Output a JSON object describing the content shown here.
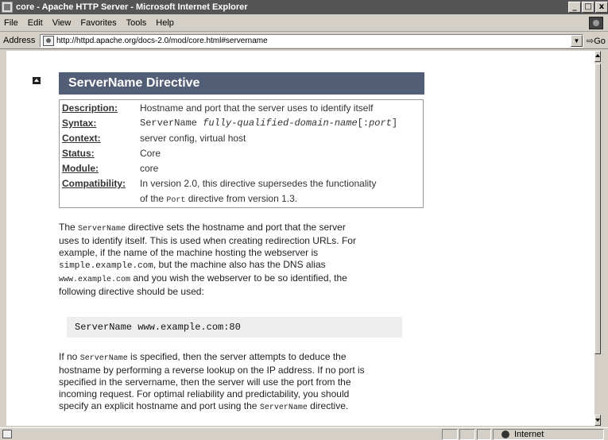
{
  "window": {
    "title": "core - Apache HTTP Server - Microsoft Internet Explorer",
    "controls": {
      "minimize": "_",
      "maximize": "□",
      "close": "x"
    }
  },
  "menu": [
    "File",
    "Edit",
    "View",
    "Favorites",
    "Tools",
    "Help"
  ],
  "address": {
    "label": "Address",
    "url": "http://httpd.apache.org/docs-2.0/mod/core.html#servername",
    "go_label": "Go"
  },
  "doc": {
    "heading": "ServerName Directive",
    "summary": {
      "description_label": "Description:",
      "description": "Hostname and port that the server uses to identify itself",
      "syntax_label": "Syntax:",
      "syntax_cmd": "ServerName ",
      "syntax_arg": "fully-qualified-domain-name",
      "syntax_opt_open": "[:",
      "syntax_port": "port",
      "syntax_opt_close": "]",
      "context_label": "Context:",
      "context": "server config, virtual host",
      "status_label": "Status:",
      "status": "Core",
      "module_label": "Module:",
      "module": "core",
      "compat_label": "Compatibility:",
      "compat_line1": "In version 2.0, this directive supersedes the functionality",
      "compat_line2_a": "of the ",
      "compat_line2_code": "Port",
      "compat_line2_b": " directive from version 1.3."
    },
    "para1": {
      "l1_a": "The ",
      "l1_code": "ServerName",
      "l1_b": " directive sets the hostname and port that the server",
      "l2": "uses to identify itself. This is used when creating redirection URLs. For",
      "l3": "example, if the name of the machine hosting the webserver is",
      "l4_code": "simple.example.com",
      "l4_b": ", but the machine also has the DNS alias",
      "l5_code": "www.example.com",
      "l5_b": " and you wish the webserver to be so identified, the",
      "l6": "following directive should be used:"
    },
    "example": "ServerName www.example.com:80",
    "para2": {
      "l1_a": "If no ",
      "l1_code": "ServerName",
      "l1_b": " is specified, then the server attempts to deduce the",
      "l2": "hostname by performing a reverse lookup on the IP address. If no port is",
      "l3": "specified in the servername, then the server will use the port from the",
      "l4": "incoming request. For optimal reliability and predictability, you should",
      "l5_a": "specify an explicit hostname and port using the ",
      "l5_code": "ServerName",
      "l5_b": " directive."
    }
  },
  "status": {
    "zone": "Internet"
  },
  "icons": [
    "ie-app-icon",
    "page-icon",
    "collapse-icon",
    "globe-icon",
    "throbber-icon"
  ]
}
